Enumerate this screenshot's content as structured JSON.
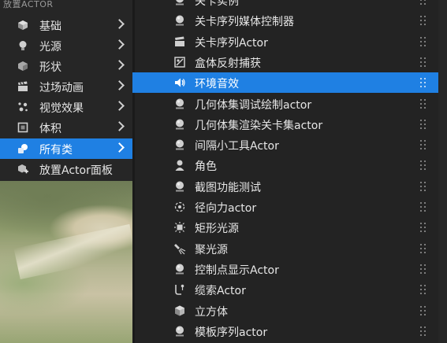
{
  "left_panel": {
    "header": "放置ACTOR",
    "items": [
      {
        "label": "基础",
        "icon": "cube-icon"
      },
      {
        "label": "光源",
        "icon": "light-bulb-icon"
      },
      {
        "label": "形状",
        "icon": "shape-icon"
      },
      {
        "label": "过场动画",
        "icon": "clapperboard-icon"
      },
      {
        "label": "视觉效果",
        "icon": "sparkle-icon"
      },
      {
        "label": "体积",
        "icon": "volume-icon"
      },
      {
        "label": "所有类",
        "icon": "classes-icon",
        "selected": true
      },
      {
        "label": "放置Actor面板",
        "icon": "place-actor-icon"
      }
    ]
  },
  "right_panel": {
    "items": [
      {
        "label": "关卡实例",
        "icon": "actor-sphere-icon",
        "partial": true
      },
      {
        "label": "关卡序列媒体控制器",
        "icon": "actor-sphere-icon"
      },
      {
        "label": "关卡序列Actor",
        "icon": "clapperboard-icon"
      },
      {
        "label": "盒体反射捕获",
        "icon": "reflection-capture-icon"
      },
      {
        "label": "环境音效",
        "icon": "speaker-icon",
        "selected": true
      },
      {
        "label": "几何体集调试绘制actor",
        "icon": "actor-sphere-icon"
      },
      {
        "label": "几何体集渲染关卡集actor",
        "icon": "actor-sphere-icon"
      },
      {
        "label": "间隔小工具Actor",
        "icon": "actor-sphere-icon"
      },
      {
        "label": "角色",
        "icon": "character-icon"
      },
      {
        "label": "截图功能测试",
        "icon": "actor-sphere-icon"
      },
      {
        "label": "径向力actor",
        "icon": "radial-force-icon"
      },
      {
        "label": "矩形光源",
        "icon": "rect-light-icon"
      },
      {
        "label": "聚光源",
        "icon": "spot-light-icon"
      },
      {
        "label": "控制点显示Actor",
        "icon": "actor-sphere-icon"
      },
      {
        "label": "缆索Actor",
        "icon": "cable-icon"
      },
      {
        "label": "立方体",
        "icon": "cube-icon"
      },
      {
        "label": "模板序列actor",
        "icon": "actor-sphere-icon"
      }
    ]
  },
  "colors": {
    "selection": "#1f80e3",
    "panel": "#232323",
    "text": "#e6e6e6"
  }
}
